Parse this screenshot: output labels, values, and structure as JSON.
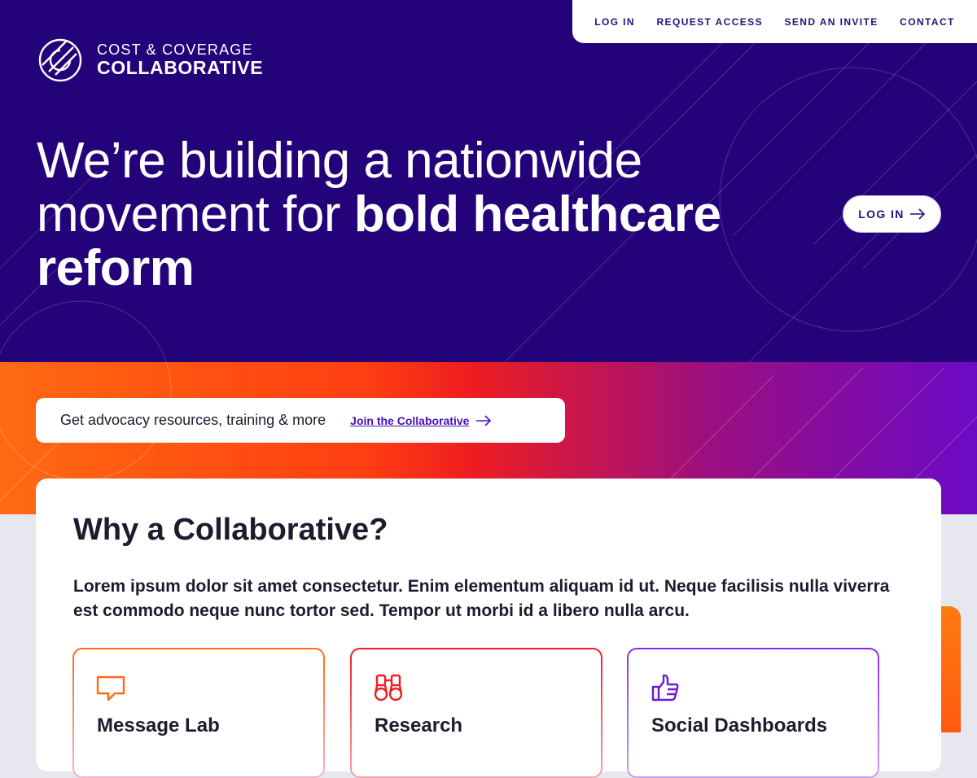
{
  "nav": {
    "items": [
      {
        "label": "LOG IN"
      },
      {
        "label": "REQUEST ACCESS"
      },
      {
        "label": "SEND AN INVITE"
      },
      {
        "label": "CONTACT"
      }
    ]
  },
  "brand": {
    "line1": "COST & COVERAGE",
    "line2": "COLLABORATIVE"
  },
  "hero": {
    "headline_regular": "We’re building a nationwide movement for ",
    "headline_bold": "bold healthcare reform",
    "login_label": "LOG IN"
  },
  "promo": {
    "text": "Get advocacy resources, training & more",
    "link_label": "Join the Collaborative"
  },
  "section": {
    "title": "Why a Collaborative?",
    "body": "Lorem ipsum dolor sit amet consectetur. Enim elementum aliquam id ut. Neque facilisis nulla viverra est commodo neque nunc tortor sed. Tempor ut morbi id a libero nulla arcu."
  },
  "features": [
    {
      "label": "Message Lab",
      "icon": "speech-bubble-icon",
      "color": "#ff6a12"
    },
    {
      "label": "Research",
      "icon": "binoculars-icon",
      "color": "#ef1d20"
    },
    {
      "label": "Social Dashboards",
      "icon": "thumbs-up-icon",
      "color": "#6b1ad6"
    }
  ],
  "colors": {
    "hero_bg": "#24037a",
    "gradient_start": "#ff6a12",
    "gradient_mid": "#ef1d20",
    "gradient_end": "#6b0ac5",
    "page_bg": "#e7e7f0"
  }
}
